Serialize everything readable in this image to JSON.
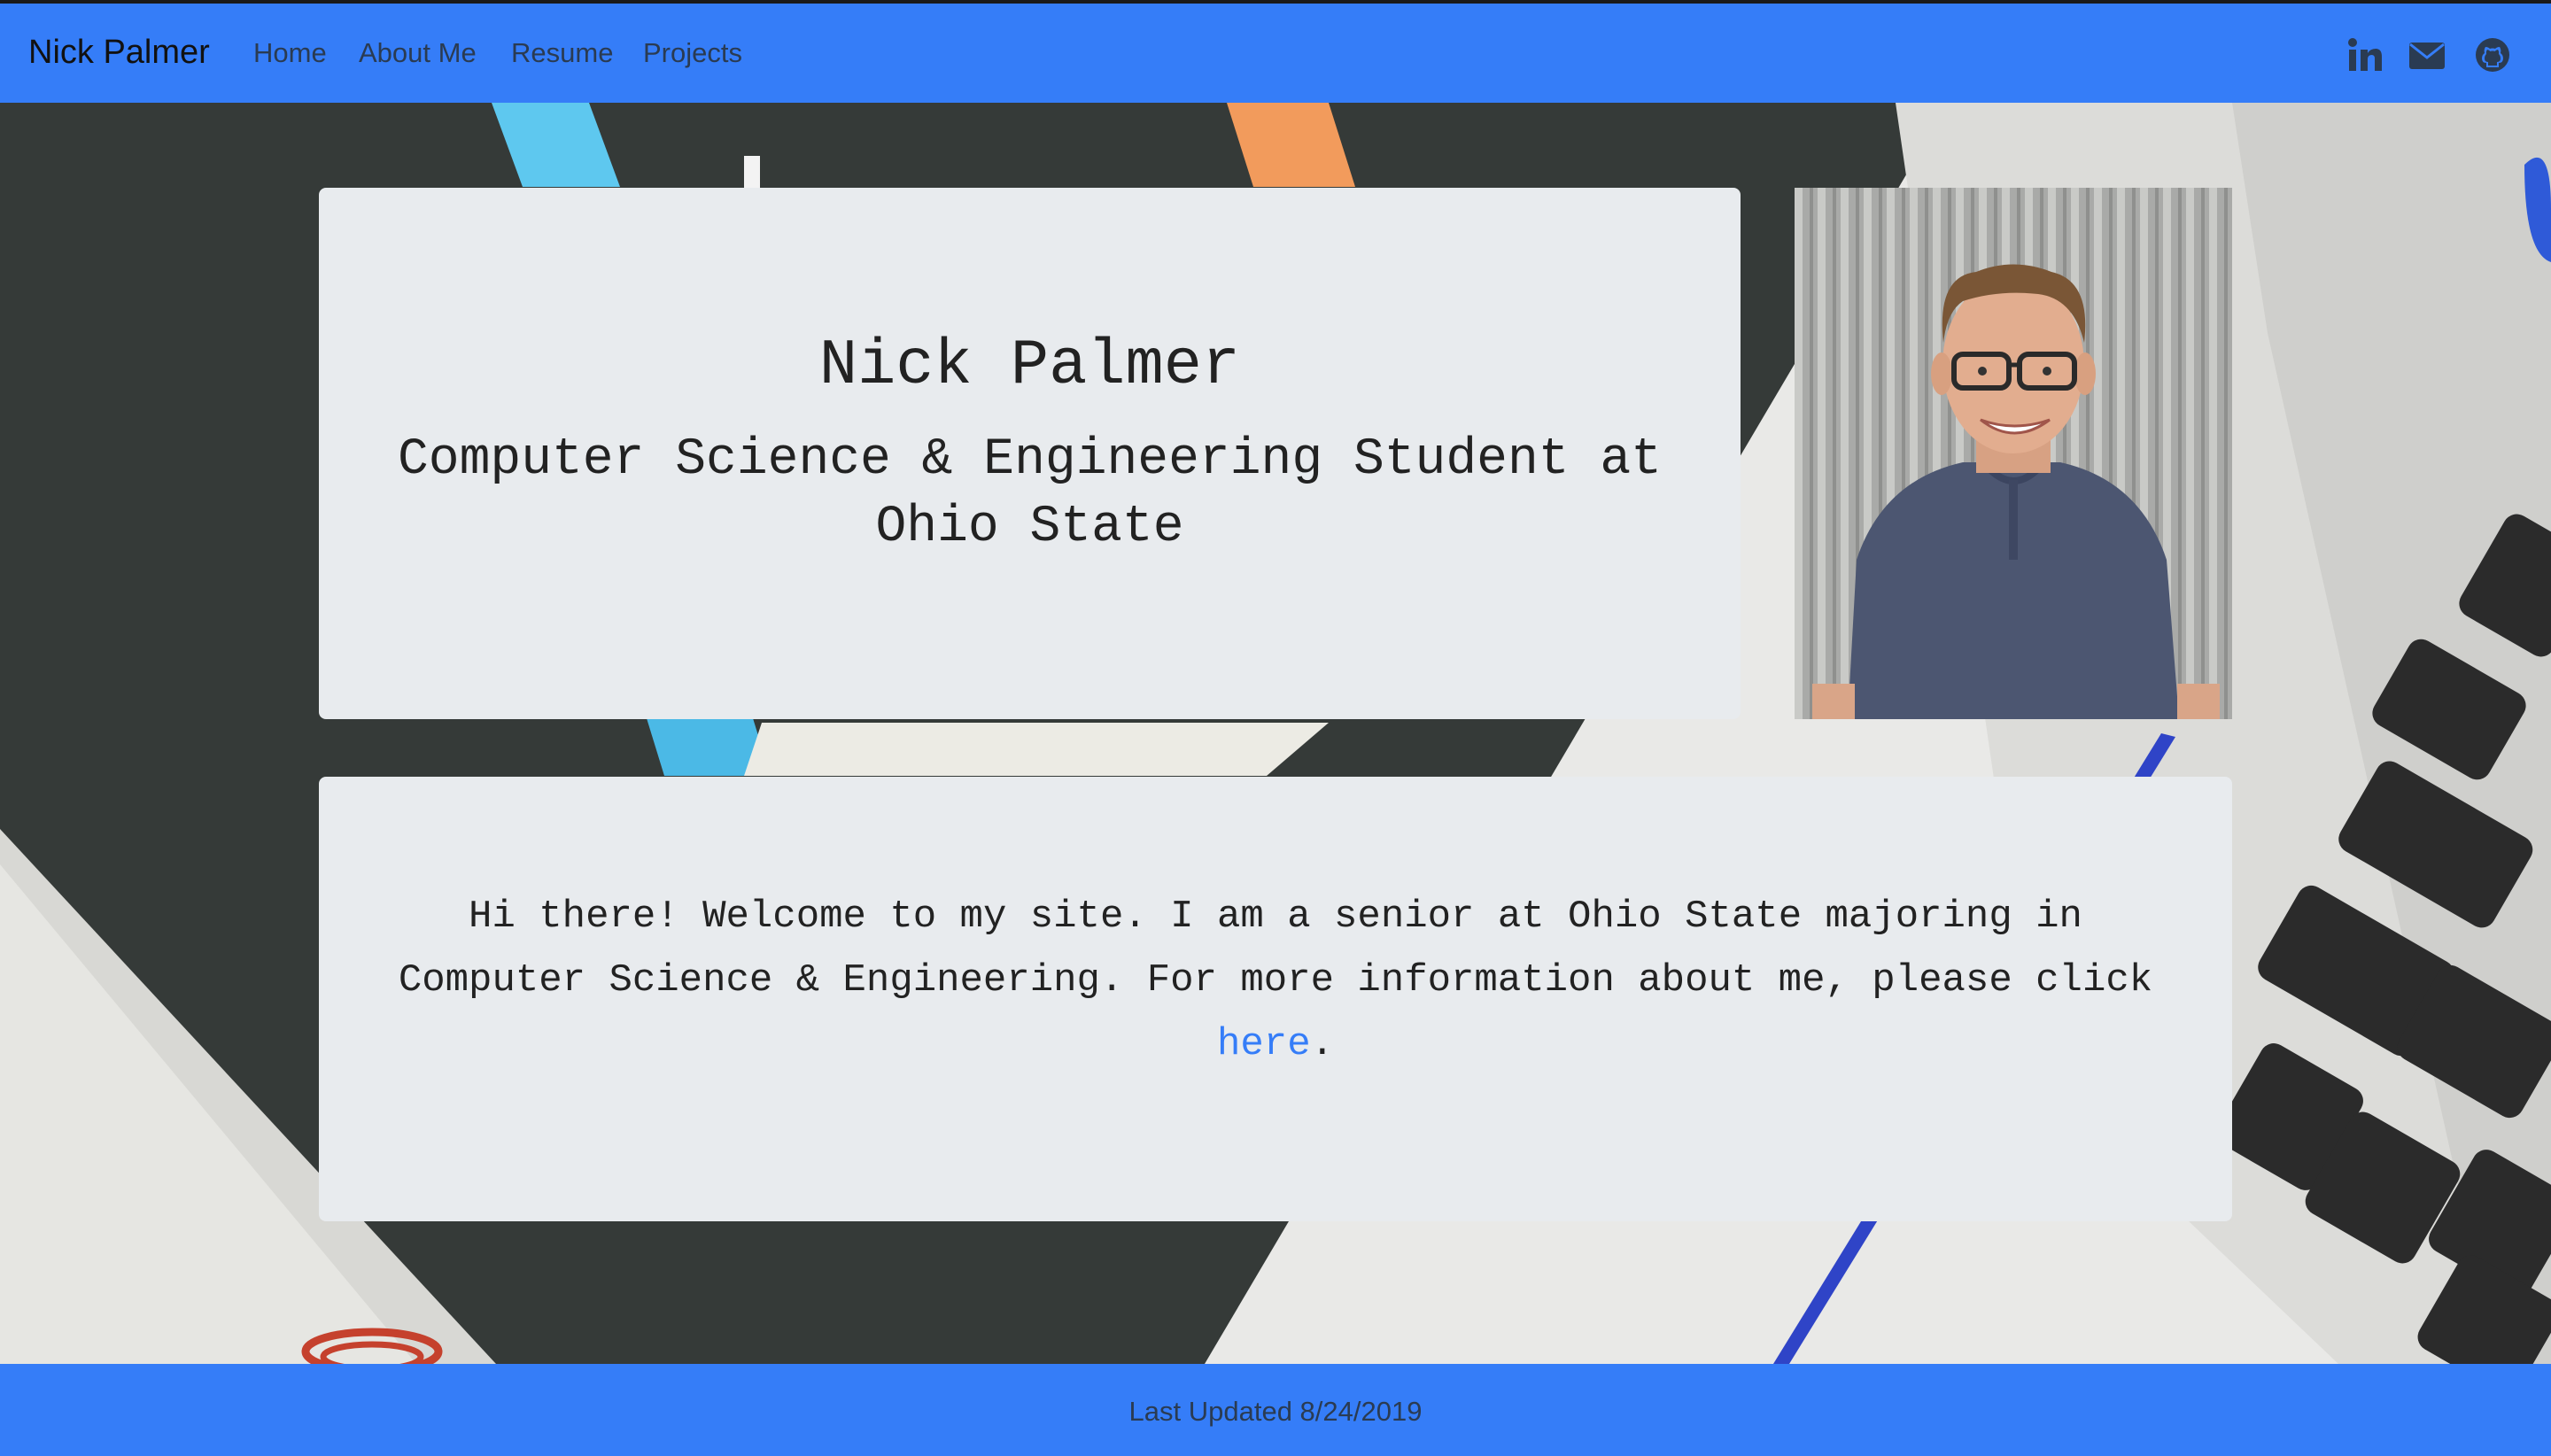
{
  "navbar": {
    "brand": "Nick Palmer",
    "links": [
      "Home",
      "About Me",
      "Resume",
      "Projects"
    ],
    "social_icons": [
      "linkedin-icon",
      "mail-icon",
      "github-icon"
    ]
  },
  "hero": {
    "name": "Nick Palmer",
    "subtitle": "Computer Science & Engineering Student at Ohio State"
  },
  "about": {
    "text_before": "Hi there! Welcome to my site. I am a senior at Ohio State majoring in Computer Science & Engineering. For more information about me, please click ",
    "link_text": "here",
    "text_after": "."
  },
  "footer": {
    "text": "Last Updated 8/24/2019"
  },
  "colors": {
    "navbar": "#357df8",
    "card": "#e8ebee",
    "link": "#357df8",
    "text": "#222222"
  }
}
